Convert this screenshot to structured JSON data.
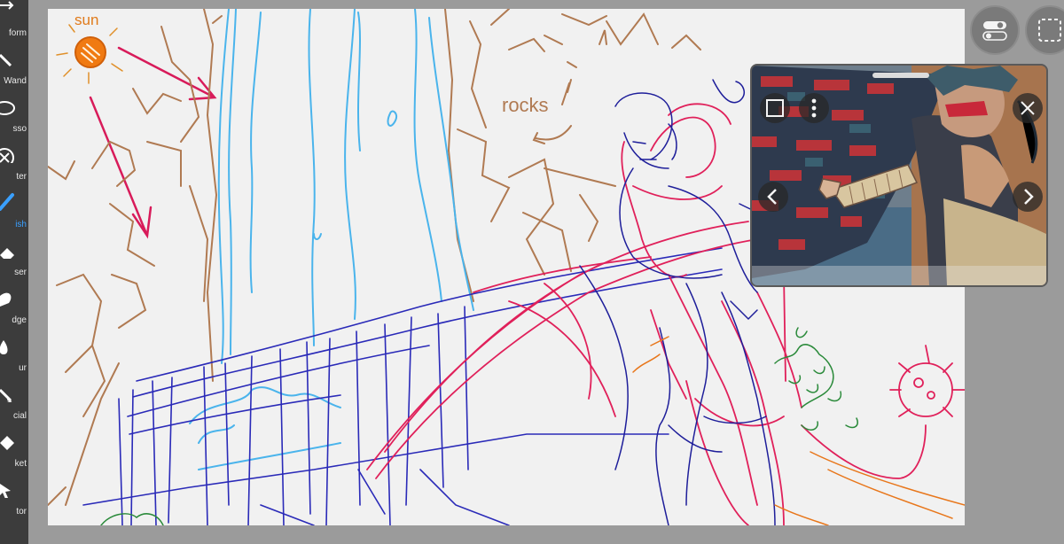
{
  "toolbar": {
    "tools": [
      {
        "label": "form",
        "icon": "transform-icon"
      },
      {
        "label": "Wand",
        "icon": "magic-wand-icon"
      },
      {
        "label": "sso",
        "icon": "lasso-icon"
      },
      {
        "label": "ter",
        "icon": "filter-icon"
      },
      {
        "label": "ish",
        "icon": "brush-icon",
        "active": true
      },
      {
        "label": "ser",
        "icon": "eraser-icon"
      },
      {
        "label": "dge",
        "icon": "smudge-icon"
      },
      {
        "label": "ur",
        "icon": "blur-icon"
      },
      {
        "label": "cial",
        "icon": "special-icon"
      },
      {
        "label": "ket",
        "icon": "bucket-icon"
      },
      {
        "label": "tor",
        "icon": "selector-icon"
      }
    ]
  },
  "canvas": {
    "annotations": {
      "sun": "sun",
      "rocks": "rocks"
    }
  },
  "reference_panel": {
    "buttons": [
      "square-icon",
      "more-icon",
      "close-icon",
      "prev-icon",
      "next-icon"
    ]
  },
  "colors": {
    "toolbar": "#3c3c3c",
    "accent": "#3aa0ff",
    "canvas": "#f1f1f1",
    "workspace": "#9b9b9b"
  }
}
